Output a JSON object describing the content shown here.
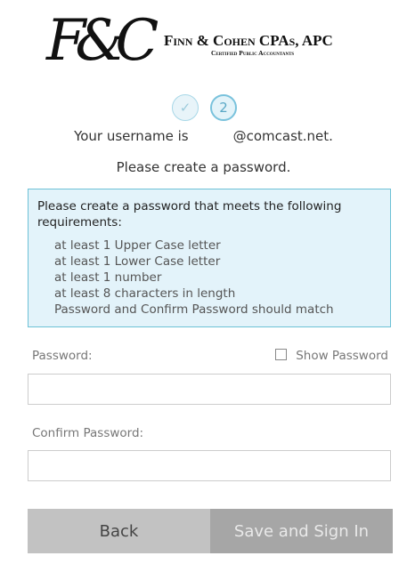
{
  "logo": {
    "monogram": "F&C",
    "name": "Finn & Cohen CPAs, APC",
    "tagline": "Certified Public Accountants"
  },
  "steps": [
    {
      "label": "✓",
      "state": "complete",
      "icon": "check-icon"
    },
    {
      "label": "2",
      "state": "current"
    }
  ],
  "messages": {
    "username_prefix": "Your username is",
    "username_suffix": "@comcast.net.",
    "create_prompt": "Please create a password."
  },
  "requirements": {
    "title": "Please create a password that meets the following requirements:",
    "items": [
      "at least 1 Upper Case letter",
      "at least 1 Lower Case letter",
      "at least 1 number",
      "at least 8 characters in length",
      "Password and Confirm Password should match"
    ]
  },
  "form": {
    "password_label": "Password:",
    "show_password_label": "Show Password",
    "show_password_checked": false,
    "password_value": "",
    "confirm_label": "Confirm Password:",
    "confirm_value": ""
  },
  "buttons": {
    "back": "Back",
    "save": "Save and Sign In"
  },
  "colors": {
    "accent": "#6cc1d6",
    "info_bg": "#e3f3fa",
    "back_button_bg": "#c2c2c2",
    "save_button_bg": "#a6a6a6"
  }
}
